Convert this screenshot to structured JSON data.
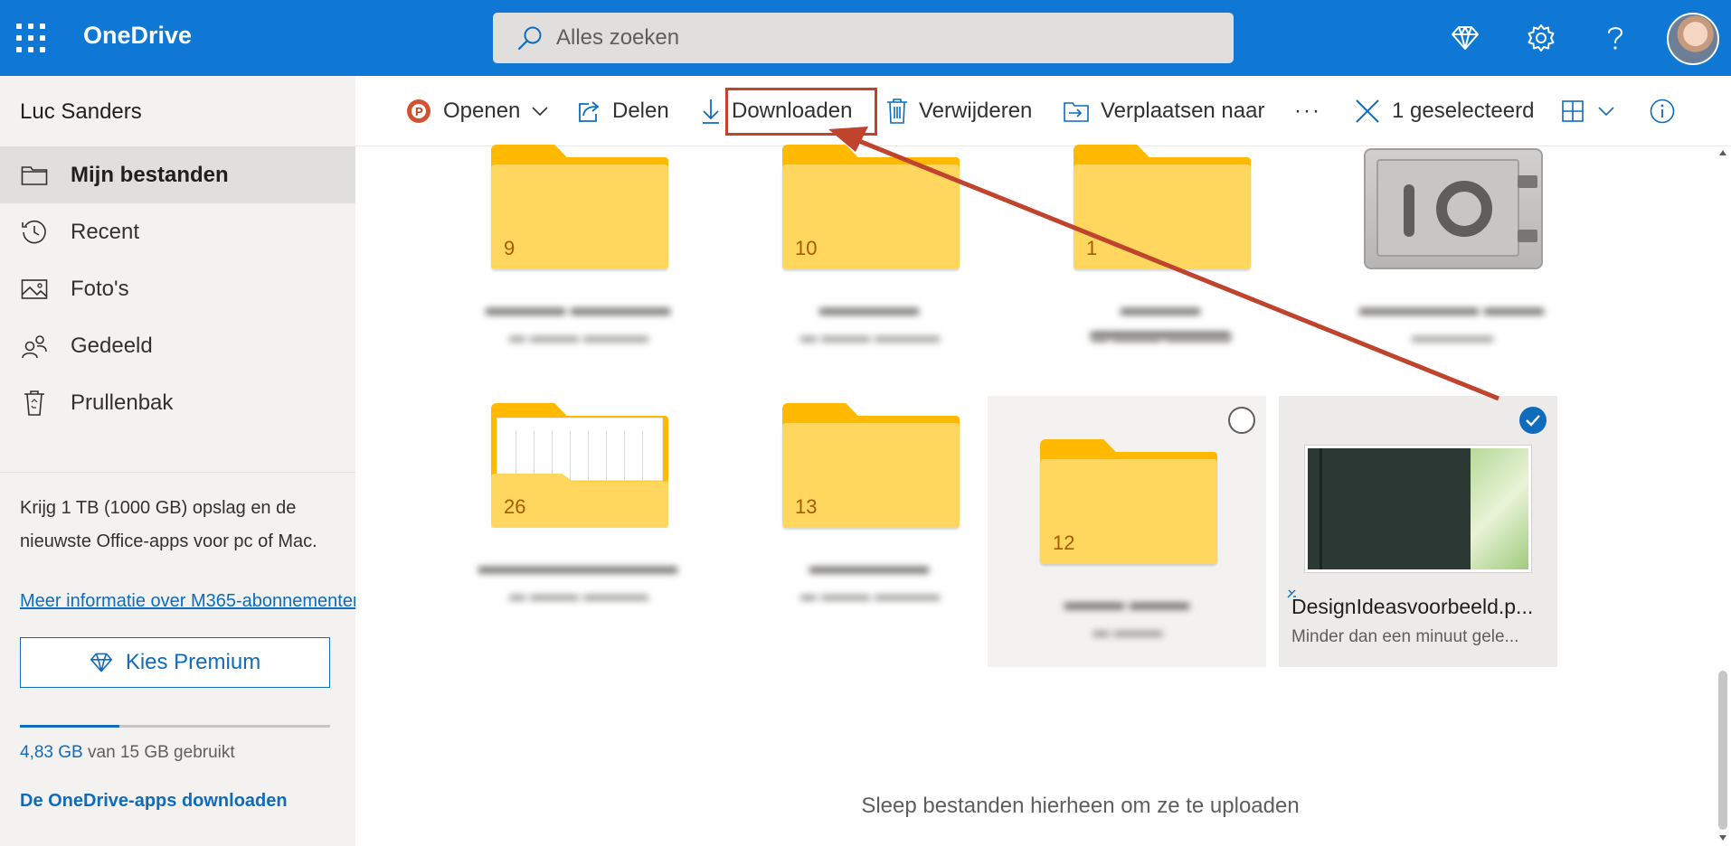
{
  "app": {
    "title": "OneDrive"
  },
  "search": {
    "placeholder": "Alles zoeken"
  },
  "user": {
    "name": "Luc Sanders"
  },
  "sidebar": {
    "items": [
      {
        "label": "Mijn bestanden",
        "icon": "folder-icon",
        "active": true
      },
      {
        "label": "Recent",
        "icon": "history-icon"
      },
      {
        "label": "Foto's",
        "icon": "photo-icon"
      },
      {
        "label": "Gedeeld",
        "icon": "people-icon"
      },
      {
        "label": "Prullenbak",
        "icon": "recycle-bin-icon"
      }
    ],
    "promo_text": "Krijg 1 TB (1000 GB) opslag en de nieuwste Office-apps voor pc of Mac.",
    "promo_link": "Meer informatie over M365-abonnementen",
    "premium_button": "Kies Premium",
    "storage": {
      "used": "4,83 GB",
      "rest": "van 15 GB gebruikt",
      "fraction": 0.322
    },
    "apps_link": "De OneDrive-apps downloaden"
  },
  "commandbar": {
    "open": "Openen",
    "share": "Delen",
    "download": "Downloaden",
    "delete": "Verwijderen",
    "move": "Verplaatsen naar",
    "more": "···",
    "selected": "1 geselecteerd"
  },
  "files": {
    "folder_counts": [
      "9",
      "10",
      "1",
      "26",
      "13",
      "12"
    ],
    "selected_file": {
      "name": "DesignIdeasvoorbeeld.p...",
      "modified": "Minder dan een minuut gele..."
    }
  },
  "drop_hint": "Sleep bestanden hierheen om ze te uploaden",
  "colors": {
    "brand": "#0f78d4",
    "accent": "#0f6cbd",
    "folder": "#ffd75e",
    "annotation": "#c0432e"
  }
}
